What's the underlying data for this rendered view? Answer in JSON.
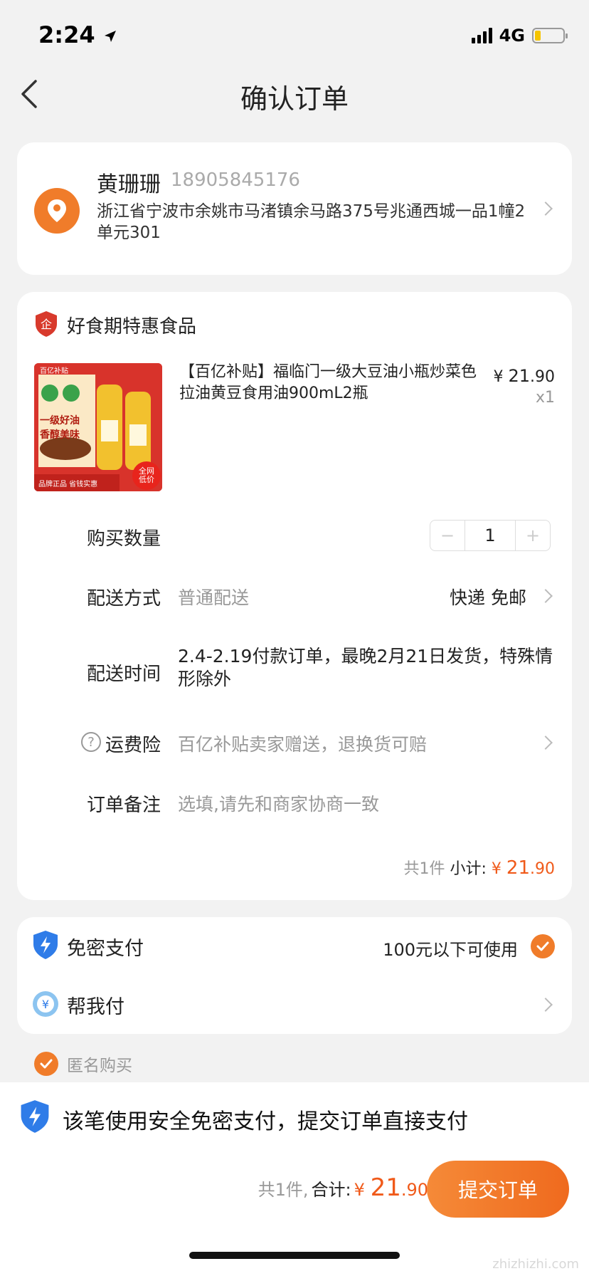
{
  "status": {
    "time": "2:24",
    "network": "4G"
  },
  "nav": {
    "title": "确认订单"
  },
  "address": {
    "name": "黄珊珊",
    "phone": "18905845176",
    "detail": "浙江省宁波市余姚市马渚镇余马路375号兆通西城一品1幢2单元301"
  },
  "store": {
    "name": "好食期特惠食品",
    "product": {
      "title": "【百亿补贴】福临门一级大豆油小瓶炒菜色拉油黄豆食用油900mL2瓶",
      "price_symbol": "¥",
      "price_int": "21",
      "price_dec": ".90",
      "qty_text": "x1",
      "image_texts": [
        "百亿补贴",
        "一级好油",
        "香醇美味",
        "全网低价",
        "品牌正品 省钱实惠"
      ]
    },
    "quantity": {
      "label": "购买数量",
      "value": "1",
      "minus": "−",
      "plus": "+"
    },
    "delivery": {
      "label": "配送方式",
      "value": "普通配送",
      "right": "快递 免邮"
    },
    "delivery_time": {
      "label": "配送时间",
      "value": "2.4-2.19付款订单，最晚2月21日发货，特殊情形除外"
    },
    "freight_insurance": {
      "label": "运费险",
      "value": "百亿补贴卖家赠送，退换货可赔"
    },
    "remark": {
      "label": "订单备注",
      "placeholder": "选填,请先和商家协商一致"
    },
    "subtotal": {
      "count_text": "共1件",
      "label": "小计:",
      "symbol": "¥",
      "int": "21",
      "dec": ".90"
    }
  },
  "payment": {
    "password_free": {
      "label": "免密支付",
      "note": "100元以下可使用"
    },
    "help_pay": {
      "label": "帮我付"
    },
    "anonymous": {
      "label": "匿名购买"
    }
  },
  "bottom": {
    "tip": "该笔使用安全免密支付，提交订单直接支付",
    "count_text": "共1件,",
    "total_label": "合计:",
    "symbol": "¥",
    "int": "21",
    "dec": ".90",
    "submit": "提交订单"
  },
  "watermark": "zhizhizhi.com",
  "colors": {
    "accent": "#f07c2a",
    "price": "#f05a1a",
    "shield_blue": "#2f7ce8"
  }
}
